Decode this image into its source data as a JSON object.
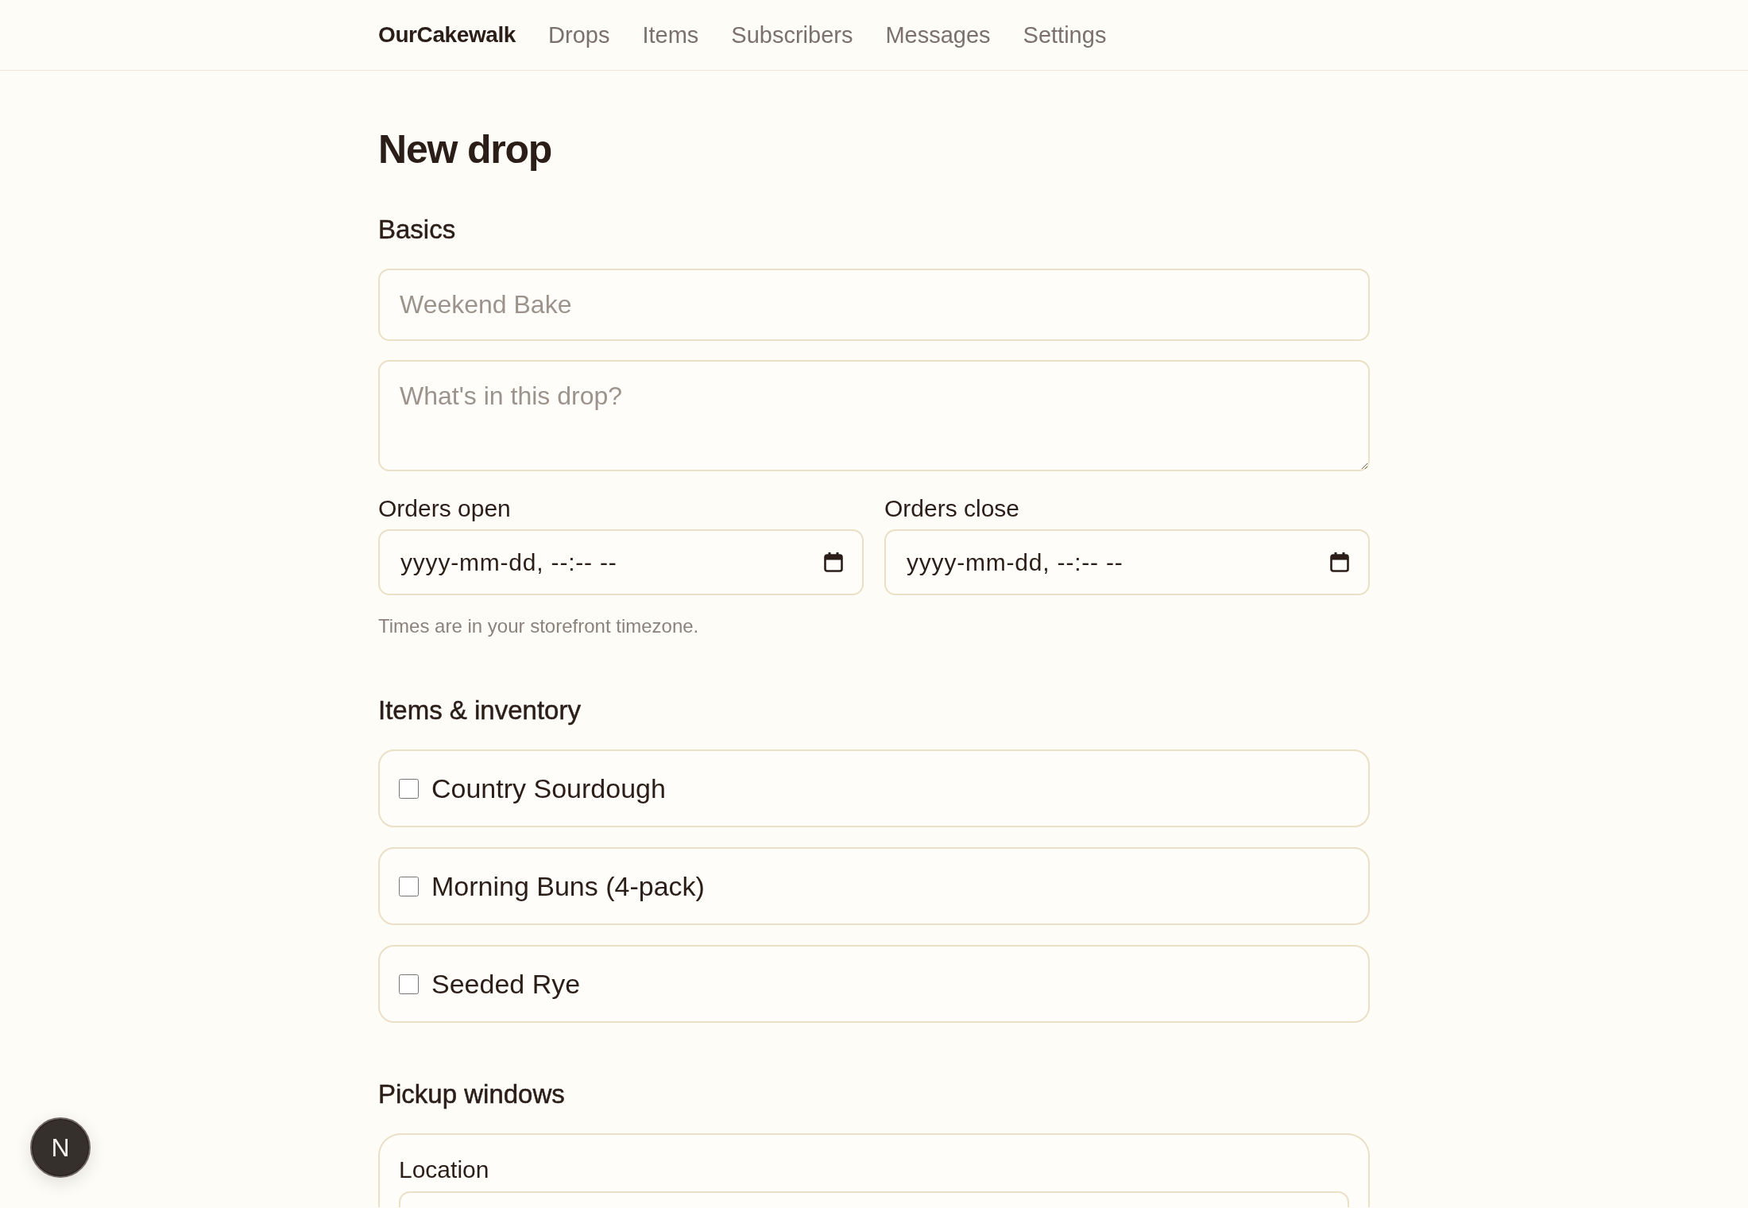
{
  "nav": {
    "brand": "OurCakewalk",
    "links": [
      {
        "label": "Drops"
      },
      {
        "label": "Items"
      },
      {
        "label": "Subscribers"
      },
      {
        "label": "Messages"
      },
      {
        "label": "Settings"
      }
    ]
  },
  "page_title": "New drop",
  "basics": {
    "heading": "Basics",
    "name_field": {
      "placeholder": "Weekend Bake"
    },
    "description_field": {
      "placeholder": "What's in this drop?"
    },
    "schedule": [
      {
        "label": "Orders open",
        "placeholder": "yyyy-mm-dd, --:-- --"
      },
      {
        "label": "Orders close",
        "placeholder": "yyyy-mm-dd, --:-- --"
      }
    ],
    "hint": "Times are in your storefront timezone."
  },
  "items_inventory": {
    "heading": "Items & inventory",
    "items": [
      {
        "name": "Country Sourdough",
        "checked": false
      },
      {
        "name": "Morning Buns (4-pack)",
        "checked": false
      },
      {
        "name": "Seeded Rye",
        "checked": false
      }
    ]
  },
  "pickup_windows": {
    "heading": "Pickup windows",
    "windows": [
      {
        "location_label": "Location"
      }
    ]
  },
  "dev_indicator": {
    "label": "N"
  }
}
